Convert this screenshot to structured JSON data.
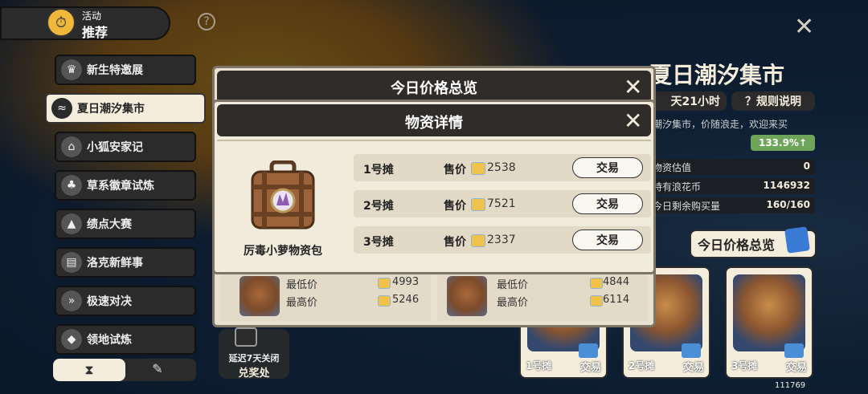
{
  "header": {
    "activity_small": "活动",
    "activity_label": "推荐"
  },
  "menu": {
    "items": [
      {
        "label": "新生特邀展",
        "icon": "trophy-icon"
      },
      {
        "label": "夏日潮汐集市",
        "icon": "wave-icon",
        "active": true
      },
      {
        "label": "小狐安家记",
        "icon": "fox-icon"
      },
      {
        "label": "草系徽章试炼",
        "icon": "leaf-icon"
      },
      {
        "label": "绩点大赛",
        "icon": "hat-icon"
      },
      {
        "label": "洛克新鲜事",
        "icon": "news-icon"
      },
      {
        "label": "极速对决",
        "icon": "speed-icon"
      },
      {
        "label": "领地试炼",
        "icon": "territory-icon"
      }
    ],
    "bottom_tab_left_icon": "hourglass-icon",
    "bottom_tab_right_icon": "pen-icon"
  },
  "market": {
    "title": "夏日潮汐集市",
    "time_left": "天21小时",
    "rules_label": "？规则说明",
    "description": "潮汐集市，价随浪走，欢迎来买",
    "percent": "133.9%↑",
    "stats": [
      {
        "label": "物资估值",
        "value": "0"
      },
      {
        "label": "持有浪花币",
        "value": "1146932"
      },
      {
        "label": "今日剩余购买量",
        "value": "160/160"
      }
    ],
    "overview_button": "今日价格总览",
    "stalls": [
      {
        "label": "1号摊",
        "trade": "交易"
      },
      {
        "label": "2号摊",
        "trade": "交易"
      },
      {
        "label": "3号摊",
        "trade": "交易"
      }
    ]
  },
  "gift": {
    "line1": "延迟7天关闭",
    "line2": "兑奖处"
  },
  "overview_dialog": {
    "title": "今日价格总览",
    "items": [
      {
        "min_label": "最低价",
        "min_value": "4993",
        "max_label": "最高价",
        "max_value": "5246"
      },
      {
        "min_label": "最低价",
        "min_value": "4844",
        "max_label": "最高价",
        "max_value": "6114"
      }
    ]
  },
  "detail_dialog": {
    "title": "物资详情",
    "item_name": "厉毒小萝物资包",
    "rows": [
      {
        "stall": "1号摊",
        "price_label": "售价",
        "price": "2538",
        "button": "交易"
      },
      {
        "stall": "2号摊",
        "price_label": "售价",
        "price": "7521",
        "button": "交易"
      },
      {
        "stall": "3号摊",
        "price_label": "售价",
        "price": "2337",
        "button": "交易"
      }
    ]
  },
  "build_id": "111769",
  "colors": {
    "cream": "#f4eddc",
    "dark": "#2b2b2b",
    "coin": "#f0c24a"
  }
}
